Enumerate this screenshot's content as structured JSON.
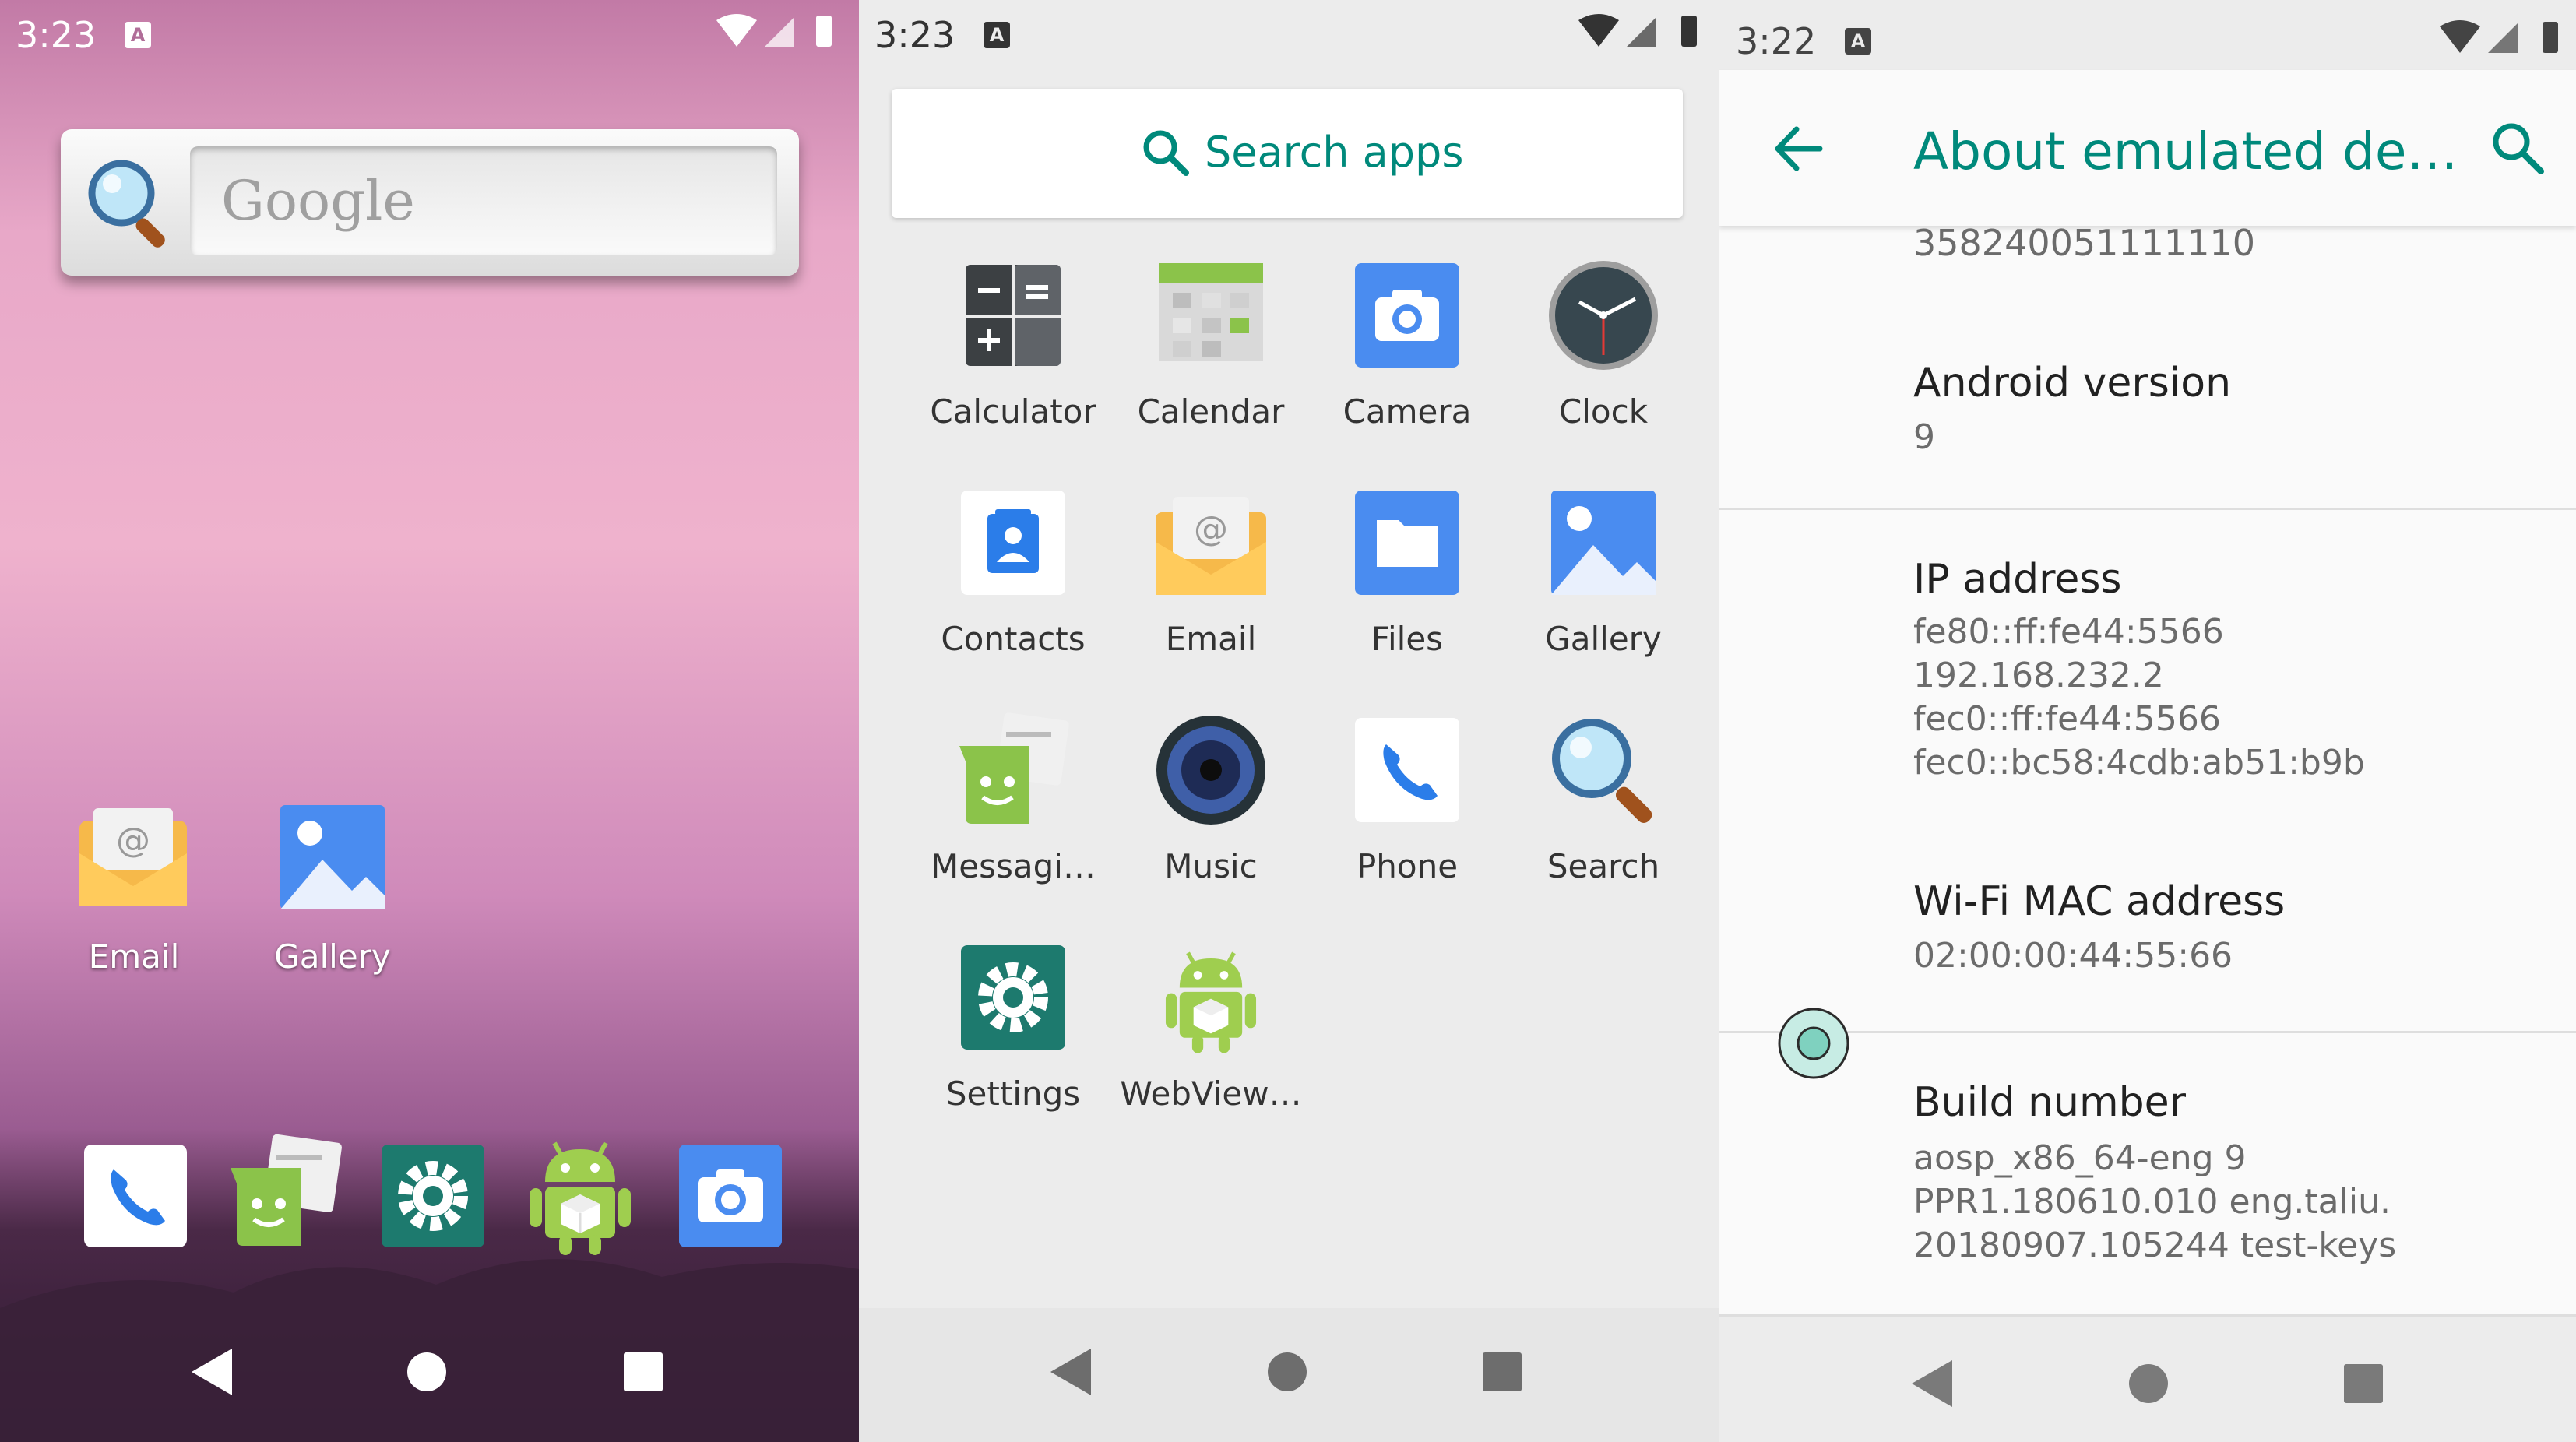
{
  "home": {
    "status_time": "3:23",
    "status_badge": "A",
    "search_widget": {
      "placeholder": "Google",
      "icon": "magnifier-icon"
    },
    "desktop_apps": [
      {
        "label": "Email",
        "icon": "email-icon"
      },
      {
        "label": "Gallery",
        "icon": "gallery-icon"
      }
    ],
    "dock": [
      "phone-icon",
      "messaging-icon",
      "settings-icon",
      "webview-android-icon",
      "camera-icon"
    ]
  },
  "drawer": {
    "status_time": "3:23",
    "status_badge": "A",
    "search_label": "Search apps",
    "apps": [
      {
        "label": "Calculator",
        "icon": "calculator-icon"
      },
      {
        "label": "Calendar",
        "icon": "calendar-icon"
      },
      {
        "label": "Camera",
        "icon": "camera-icon"
      },
      {
        "label": "Clock",
        "icon": "clock-icon"
      },
      {
        "label": "Contacts",
        "icon": "contacts-icon"
      },
      {
        "label": "Email",
        "icon": "email-icon"
      },
      {
        "label": "Files",
        "icon": "files-icon"
      },
      {
        "label": "Gallery",
        "icon": "gallery-icon"
      },
      {
        "label": "Messagi…",
        "icon": "messaging-icon"
      },
      {
        "label": "Music",
        "icon": "music-icon"
      },
      {
        "label": "Phone",
        "icon": "phone-icon"
      },
      {
        "label": "Search",
        "icon": "search-icon"
      },
      {
        "label": "Settings",
        "icon": "settings-icon"
      },
      {
        "label": "WebView…",
        "icon": "webview-android-icon"
      }
    ]
  },
  "about": {
    "status_time": "3:22",
    "status_badge": "A",
    "title": "About emulated de…",
    "partial_value": "358240051111110",
    "items": [
      {
        "title": "Android version",
        "value": [
          "9"
        ]
      },
      {
        "title": "IP address",
        "value": [
          "fe80::ff:fe44:5566",
          "192.168.232.2",
          "fec0::ff:fe44:5566",
          "fec0::bc58:4cdb:ab51:b9b"
        ]
      },
      {
        "title": "Wi-Fi MAC address",
        "value": [
          "02:00:00:44:55:66"
        ]
      },
      {
        "title": "Build number",
        "value": [
          "aosp_x86_64-eng 9",
          "PPR1.180610.010 eng.taliu.",
          "20180907.105244 test-keys"
        ]
      }
    ]
  },
  "colors": {
    "accent": "#00897b",
    "nav_button": "#7a7a7a"
  }
}
